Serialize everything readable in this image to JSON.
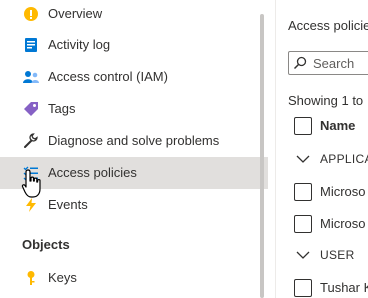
{
  "sidebar": {
    "items": [
      {
        "label": "Overview",
        "icon": "overview-icon"
      },
      {
        "label": "Activity log",
        "icon": "activity-log-icon"
      },
      {
        "label": "Access control (IAM)",
        "icon": "iam-icon"
      },
      {
        "label": "Tags",
        "icon": "tag-icon"
      },
      {
        "label": "Diagnose and solve problems",
        "icon": "wrench-icon"
      },
      {
        "label": "Access policies",
        "icon": "access-policies-icon",
        "selected": true
      },
      {
        "label": "Events",
        "icon": "lightning-icon"
      }
    ],
    "section_objects": "Objects",
    "objects_items": [
      {
        "label": "Keys",
        "icon": "key-icon"
      }
    ]
  },
  "main": {
    "title": "Access policie",
    "search_placeholder": "Search",
    "showing_text": "Showing 1 to",
    "columns": {
      "name": "Name"
    },
    "groups": [
      {
        "label": "APPLICA",
        "rows": [
          "Microso",
          "Microso"
        ]
      },
      {
        "label": "USER",
        "rows": [
          "Tushar K"
        ]
      }
    ]
  },
  "colors": {
    "selected_bg": "#e1dfdd",
    "text": "#323130",
    "accent": "#0078d4"
  }
}
